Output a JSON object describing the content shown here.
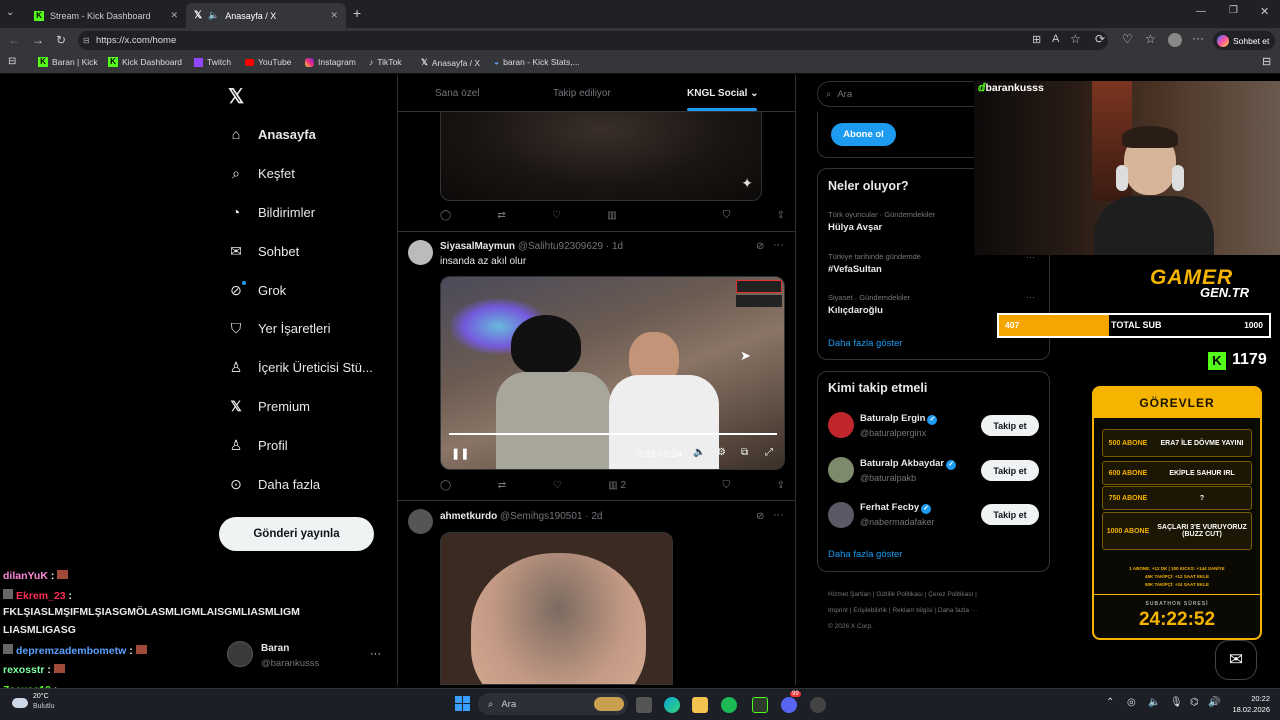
{
  "browser": {
    "tabs": [
      {
        "title": "Stream - Kick Dashboard"
      },
      {
        "title": "Anasayfa / X"
      }
    ],
    "new_tab": "+",
    "url": "https://x.com/home",
    "copilot": "Sohbet et",
    "bookmarks": [
      "Baran | Kick",
      "Kick Dashboard",
      "Twitch",
      "YouTube",
      "Instagram",
      "TikTok",
      "Anasayfa / X",
      "baran - Kick Stats,..."
    ]
  },
  "nav": {
    "items": [
      "Anasayfa",
      "Keşfet",
      "Bildirimler",
      "Sohbet",
      "Grok",
      "Yer İşaretleri",
      "İçerik Üreticisi Stü...",
      "Premium",
      "Profil",
      "Daha fazla"
    ],
    "post_button": "Gönderi yayınla",
    "account": {
      "name": "Baran",
      "handle": "@barankusss"
    }
  },
  "feed": {
    "tabs": [
      "Sana özel",
      "Takip ediliyor",
      "KNGL Social"
    ],
    "posts": [
      {
        "author": "SiyasalMaymun",
        "handle": "@Salihtu92309629",
        "time": "· 1d",
        "text": "insanda az akıl olur",
        "video_time": "0:33 / 0:34",
        "views": "2"
      },
      {
        "author": "ahmetkurdo",
        "handle": "@Semihgs190501",
        "time": "· 2d"
      }
    ]
  },
  "sidebar": {
    "search_placeholder": "Ara",
    "subscribe": "Abone ol",
    "trends_title": "Neler oluyor?",
    "trends": [
      {
        "category": "Türk oyuncular · Gündemdekiler",
        "title": "Hülya Avşar"
      },
      {
        "category": "Türkiye tarihinde gündemde",
        "title": "#VefaSultan"
      },
      {
        "category": "Siyaset · Gündemdekiler",
        "title": "Kılıçdaroğlu"
      }
    ],
    "show_more": "Daha fazla göster",
    "who_title": "Kimi takip etmeli",
    "who": [
      {
        "name": "Baturalp Ergin",
        "handle": "@baturalperginx",
        "btn": "Takip et"
      },
      {
        "name": "Baturalp Akbaydar",
        "handle": "@baturalpakb",
        "btn": "Takip et"
      },
      {
        "name": "Ferhat Fecby",
        "handle": "@nabermadafaker",
        "btn": "Takip et"
      }
    ],
    "footer": [
      "Hizmet Şartları",
      "Gizlilik Politikası",
      "Çerez Politikası",
      "Imprint",
      "Erişilebilirlik",
      "Reklam bilgisi",
      "Daha fazla ···",
      "© 2026 X Corp."
    ]
  },
  "overlay": {
    "webcam_name": "barankusss",
    "brand_top": "GAMER",
    "brand_bottom": "GEN.TR",
    "sub_current": "407",
    "sub_label": "TOTAL SUB",
    "sub_goal": "1000",
    "sub_progress": 0.407,
    "kick_count": "1179",
    "tasks_title": "GÖREVLER",
    "tasks": [
      {
        "left": "500 ABONE",
        "right": "ERA7 İLE DÖVME YAYINI"
      },
      {
        "left": "600 ABONE",
        "right": "EKİPLE SAHUR IRL"
      },
      {
        "left": "750 ABONE",
        "right": "?"
      },
      {
        "left": "1000 ABONE",
        "right": "SAÇLARI 3'E VURUYORUZ (BUZZ CUT)"
      }
    ],
    "rules": [
      "1 ABONE: +12 DK | 100 KICKS: +144 SANİYE",
      "45K TAKİPÇİ: +12 SAAT EKLE",
      "50K TAKİPÇİ: +24 SAAT EKLE"
    ],
    "timer_label": "SUBATHON SÜRESİ",
    "timer": "24:22:52",
    "chat": [
      {
        "user": "dilanYuK",
        "msg": " :",
        "color": "#ff8ad8"
      },
      {
        "user": "Ekrem_23",
        "msg": " :",
        "color": "#ff2d55"
      },
      {
        "user": "",
        "msg": "FKLŞIASLMŞIFMLŞIASGMÖLASMLIGMLAISGMLIASMLIGM",
        "color": "#fff"
      },
      {
        "user": "",
        "msg": "LIASMLIGASG",
        "color": "#fff"
      },
      {
        "user": "depremzadembometw",
        "msg": " :",
        "color": "#5aa0ff"
      },
      {
        "user": "rexosstr",
        "msg": " :",
        "color": "#7cffa0"
      },
      {
        "user": "Zeeuss10",
        "msg": " :",
        "color": "#53fc18"
      }
    ]
  },
  "taskbar": {
    "weather_temp": "20°C",
    "weather_desc": "Bulutlu",
    "search": "Ara",
    "time": "20:22",
    "date": "18.02.2026",
    "badge": "99"
  }
}
